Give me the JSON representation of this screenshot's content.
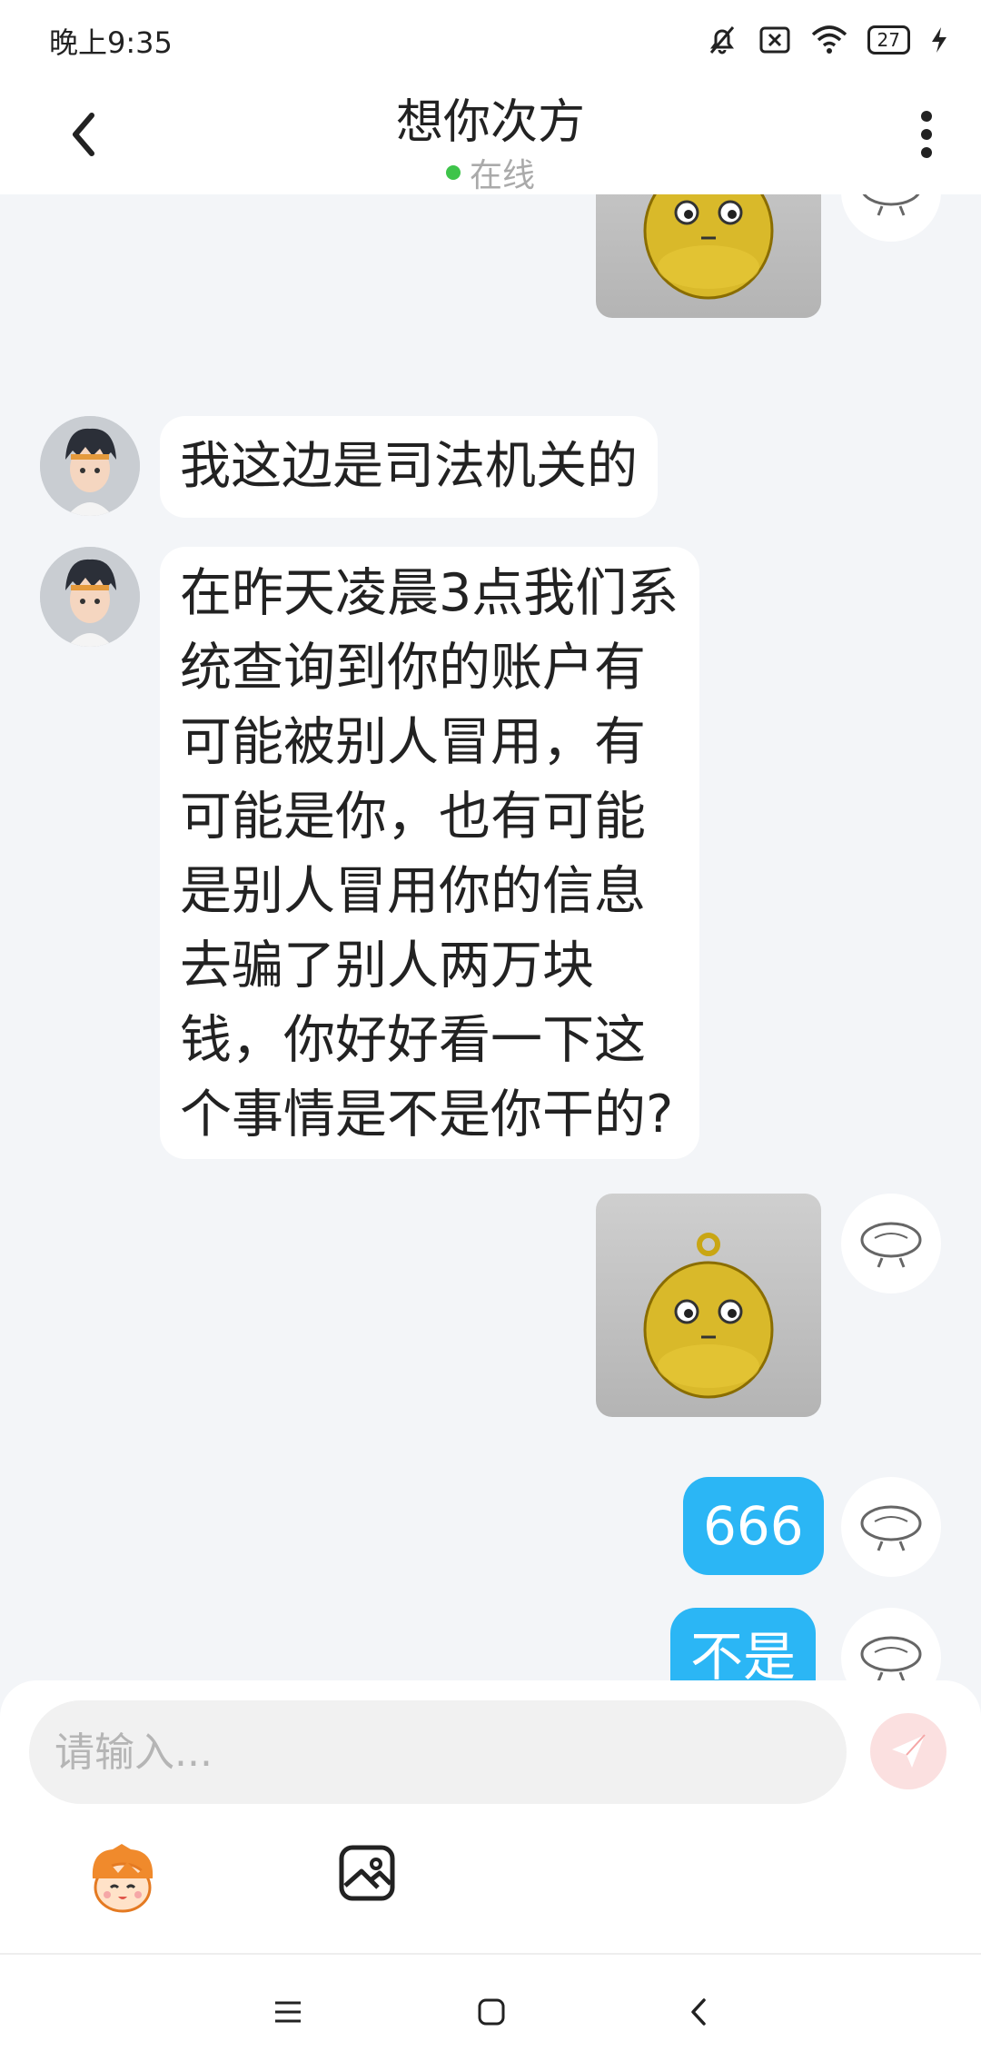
{
  "status_bar": {
    "time": "晚上9:35",
    "battery": "27"
  },
  "header": {
    "title": "想你次方",
    "status": "在线"
  },
  "messages": [
    {
      "text": "我这边是司法机关的"
    },
    {
      "text": "在昨天凌晨3点我们系统查询到你的账户有可能被别人冒用，有可能是你，也有可能是别人冒用你的信息去骗了别人两万块钱，你好好看一下这个事情是不是你干的?"
    },
    {
      "text": "666"
    },
    {
      "text": "不是"
    }
  ],
  "input": {
    "placeholder": "请输入..."
  },
  "colors": {
    "bubble_self": "#2bb6f5",
    "online": "#3ec44a",
    "send_button": "#f5a7a7"
  },
  "icons": [
    "back-icon",
    "more-icon",
    "emoji-icon",
    "image-icon",
    "send-icon",
    "menu-icon",
    "home-icon",
    "nav-back-icon"
  ]
}
